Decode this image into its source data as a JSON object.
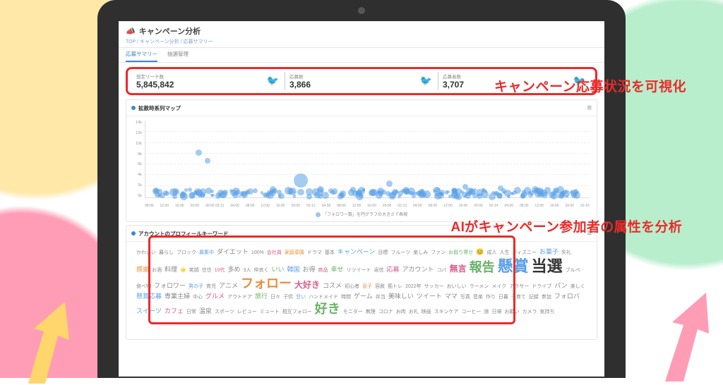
{
  "page": {
    "title": "キャンペーン分析",
    "breadcrumb": "TOP / キャンペーン分析 / 応募サマリー"
  },
  "tabs": [
    {
      "label": "応募サマリー",
      "active": true
    },
    {
      "label": "抽選管理",
      "active": false
    }
  ],
  "metrics": [
    {
      "label": "想定リーチ数",
      "value": "5,845,842"
    },
    {
      "label": "応募数",
      "value": "3,866"
    },
    {
      "label": "応募者数",
      "value": "3,707"
    }
  ],
  "callouts": {
    "c1": "キャンペーン応募状況を可視化",
    "c2": "AIがキャンペーン参加者の属性を分析"
  },
  "timechart": {
    "title": "拡散時系列マップ",
    "y_ticks": [
      "14k",
      "12k",
      "10k",
      "8k",
      "6k",
      "4k",
      "2k",
      "0k"
    ],
    "x_ticks": [
      "08:00",
      "12:00",
      "16:00",
      "20:00",
      "00:00 02-11",
      "04:00",
      "08:00",
      "12:00",
      "16:00",
      "20:00",
      "02-12",
      "04:00",
      "08:00",
      "12:00",
      "16:00",
      "20:00",
      "02-13",
      "04:00",
      "08:00",
      "12:00",
      "16:00",
      "20:00",
      "02-14",
      "04:00",
      "08:00",
      "12:00",
      "16:00",
      "20:00",
      "02-15"
    ],
    "legend": "「フォロワー数」を円グラフの大きさで表現"
  },
  "wordcloud": {
    "title": "アカウントのプロフィールキーワード",
    "words": [
      {
        "t": "かわいい",
        "s": 1,
        "c": 6
      },
      {
        "t": "暮らし",
        "s": 1,
        "c": 6
      },
      {
        "t": "ブロック",
        "s": 1,
        "c": 6
      },
      {
        "t": "募集中",
        "s": 1,
        "c": 1
      },
      {
        "t": "ダイエット",
        "s": 2,
        "c": 6
      },
      {
        "t": "100%",
        "s": 1,
        "c": 6
      },
      {
        "t": "会社員",
        "s": 1,
        "c": 5
      },
      {
        "t": "家庭菜園",
        "s": 1,
        "c": 3
      },
      {
        "t": "ドラマ",
        "s": 1,
        "c": 6
      },
      {
        "t": "基本",
        "s": 1,
        "c": 6
      },
      {
        "t": "キャンペーン",
        "s": 2,
        "c": 1
      },
      {
        "t": "目標",
        "s": 1,
        "c": 6
      },
      {
        "t": "フルーツ",
        "s": 1,
        "c": 6
      },
      {
        "t": "楽しみ",
        "s": 1,
        "c": 6
      },
      {
        "t": "ファン",
        "s": 1,
        "c": 6
      },
      {
        "t": "お取り寄せ",
        "s": 1,
        "c": 2
      },
      {
        "t": "😊",
        "s": 2,
        "c": 6
      },
      {
        "t": "成人",
        "s": 1,
        "c": 6
      },
      {
        "t": "人生",
        "s": 1,
        "c": 6
      },
      {
        "t": "ディズニー",
        "s": 1,
        "c": 6
      },
      {
        "t": "お菓子",
        "s": 2,
        "c": 1
      },
      {
        "t": "失礼",
        "s": 1,
        "c": 6
      },
      {
        "t": "感謝",
        "s": 2,
        "c": 3
      },
      {
        "t": "お酒",
        "s": 1,
        "c": 6
      },
      {
        "t": "料理",
        "s": 2,
        "c": 6
      },
      {
        "t": "🌟",
        "s": 1,
        "c": 6
      },
      {
        "t": "笑顔",
        "s": 1,
        "c": 6
      },
      {
        "t": "住住",
        "s": 1,
        "c": 6
      },
      {
        "t": "10代",
        "s": 1,
        "c": 5
      },
      {
        "t": "多め",
        "s": 2,
        "c": 6
      },
      {
        "t": "3人",
        "s": 1,
        "c": 6
      },
      {
        "t": "仲良く",
        "s": 1,
        "c": 6
      },
      {
        "t": "いい",
        "s": 2,
        "c": 2
      },
      {
        "t": "韓国",
        "s": 2,
        "c": 1
      },
      {
        "t": "お得",
        "s": 2,
        "c": 6
      },
      {
        "t": "商品",
        "s": 1,
        "c": 5
      },
      {
        "t": "幸せ",
        "s": 2,
        "c": 2
      },
      {
        "t": "リツイート",
        "s": 1,
        "c": 6
      },
      {
        "t": "返信",
        "s": 1,
        "c": 6
      },
      {
        "t": "応募",
        "s": 2,
        "c": 5
      },
      {
        "t": "アカウント",
        "s": 2,
        "c": 6
      },
      {
        "t": "コバ",
        "s": 1,
        "c": 6
      },
      {
        "t": "無言",
        "s": 3,
        "c": 5
      },
      {
        "t": "報告",
        "s": 4,
        "c": 2
      },
      {
        "t": "懸賞",
        "s": 5,
        "c": 1
      },
      {
        "t": "当選",
        "s": 5,
        "c": 4
      },
      {
        "t": "ブルベ",
        "s": 1,
        "c": 6
      },
      {
        "t": "食べ物",
        "s": 1,
        "c": 6
      },
      {
        "t": "フォロワー",
        "s": 2,
        "c": 6
      },
      {
        "t": "男の子",
        "s": 1,
        "c": 1
      },
      {
        "t": "育児",
        "s": 1,
        "c": 6
      },
      {
        "t": "アニメ",
        "s": 2,
        "c": 6
      },
      {
        "t": "フォロー",
        "s": 4,
        "c": 3
      },
      {
        "t": "大好き",
        "s": 3,
        "c": 5
      },
      {
        "t": "コスメ",
        "s": 2,
        "c": 6
      },
      {
        "t": "初心者",
        "s": 1,
        "c": 6
      },
      {
        "t": "息子",
        "s": 1,
        "c": 3
      },
      {
        "t": "容赦",
        "s": 1,
        "c": 6
      },
      {
        "t": "筋トレ",
        "s": 1,
        "c": 6
      },
      {
        "t": "2022年",
        "s": 1,
        "c": 6
      },
      {
        "t": "サッカー",
        "s": 1,
        "c": 6
      },
      {
        "t": "おいしい",
        "s": 1,
        "c": 6
      },
      {
        "t": "ラーメン",
        "s": 1,
        "c": 6
      },
      {
        "t": "メイク",
        "s": 1,
        "c": 6
      },
      {
        "t": "アラサー",
        "s": 1,
        "c": 6
      },
      {
        "t": "ドライブ",
        "s": 1,
        "c": 6
      },
      {
        "t": "パン",
        "s": 2,
        "c": 6
      },
      {
        "t": "楽しく",
        "s": 1,
        "c": 6
      },
      {
        "t": "懸賞応募",
        "s": 2,
        "c": 1
      },
      {
        "t": "専業主婦",
        "s": 2,
        "c": 6
      },
      {
        "t": "中心",
        "s": 1,
        "c": 6
      },
      {
        "t": "グルメ",
        "s": 2,
        "c": 5
      },
      {
        "t": "アウトドア",
        "s": 1,
        "c": 6
      },
      {
        "t": "旅行",
        "s": 2,
        "c": 2
      },
      {
        "t": "日々",
        "s": 1,
        "c": 6
      },
      {
        "t": "子供",
        "s": 1,
        "c": 6
      },
      {
        "t": "甘い",
        "s": 1,
        "c": 1
      },
      {
        "t": "ハンドメイド",
        "s": 1,
        "c": 6
      },
      {
        "t": "時間",
        "s": 1,
        "c": 6
      },
      {
        "t": "ゲーム",
        "s": 2,
        "c": 6
      },
      {
        "t": "弁当",
        "s": 1,
        "c": 6
      },
      {
        "t": "美味しい",
        "s": 2,
        "c": 6
      },
      {
        "t": "ツイート",
        "s": 2,
        "c": 6
      },
      {
        "t": "ママ",
        "s": 2,
        "c": 6
      },
      {
        "t": "写真",
        "s": 1,
        "c": 6
      },
      {
        "t": "音楽",
        "s": 1,
        "c": 6
      },
      {
        "t": "作り",
        "s": 1,
        "c": 6
      },
      {
        "t": "日暮",
        "s": 1,
        "c": 6
      },
      {
        "t": "子育て",
        "s": 1,
        "c": 6
      },
      {
        "t": "記録",
        "s": 1,
        "c": 6
      },
      {
        "t": "参加",
        "s": 1,
        "c": 6
      },
      {
        "t": "フォロバ",
        "s": 2,
        "c": 6
      },
      {
        "t": "スイーツ",
        "s": 2,
        "c": 1
      },
      {
        "t": "カフェ",
        "s": 2,
        "c": 5
      },
      {
        "t": "日常",
        "s": 1,
        "c": 6
      },
      {
        "t": "温泉",
        "s": 2,
        "c": 6
      },
      {
        "t": "スポーツ",
        "s": 1,
        "c": 6
      },
      {
        "t": "レビュー",
        "s": 1,
        "c": 6
      },
      {
        "t": "ミュート",
        "s": 1,
        "c": 6
      },
      {
        "t": "相互フォロー",
        "s": 1,
        "c": 6
      },
      {
        "t": "好き",
        "s": 4,
        "c": 2
      },
      {
        "t": "モニター",
        "s": 1,
        "c": 6
      },
      {
        "t": "無理",
        "s": 1,
        "c": 6
      },
      {
        "t": "コロナ",
        "s": 1,
        "c": 6
      },
      {
        "t": "お肉",
        "s": 1,
        "c": 6
      },
      {
        "t": "お礼",
        "s": 1,
        "c": 6
      },
      {
        "t": "映画",
        "s": 1,
        "c": 6
      },
      {
        "t": "スキンケア",
        "s": 1,
        "c": 6
      },
      {
        "t": "コーヒー",
        "s": 1,
        "c": 6
      },
      {
        "t": "旅",
        "s": 1,
        "c": 6
      },
      {
        "t": "日帰",
        "s": 1,
        "c": 6
      },
      {
        "t": "お願い",
        "s": 1,
        "c": 6
      },
      {
        "t": "カメラ",
        "s": 1,
        "c": 6
      },
      {
        "t": "気持ち",
        "s": 1,
        "c": 6
      }
    ]
  }
}
